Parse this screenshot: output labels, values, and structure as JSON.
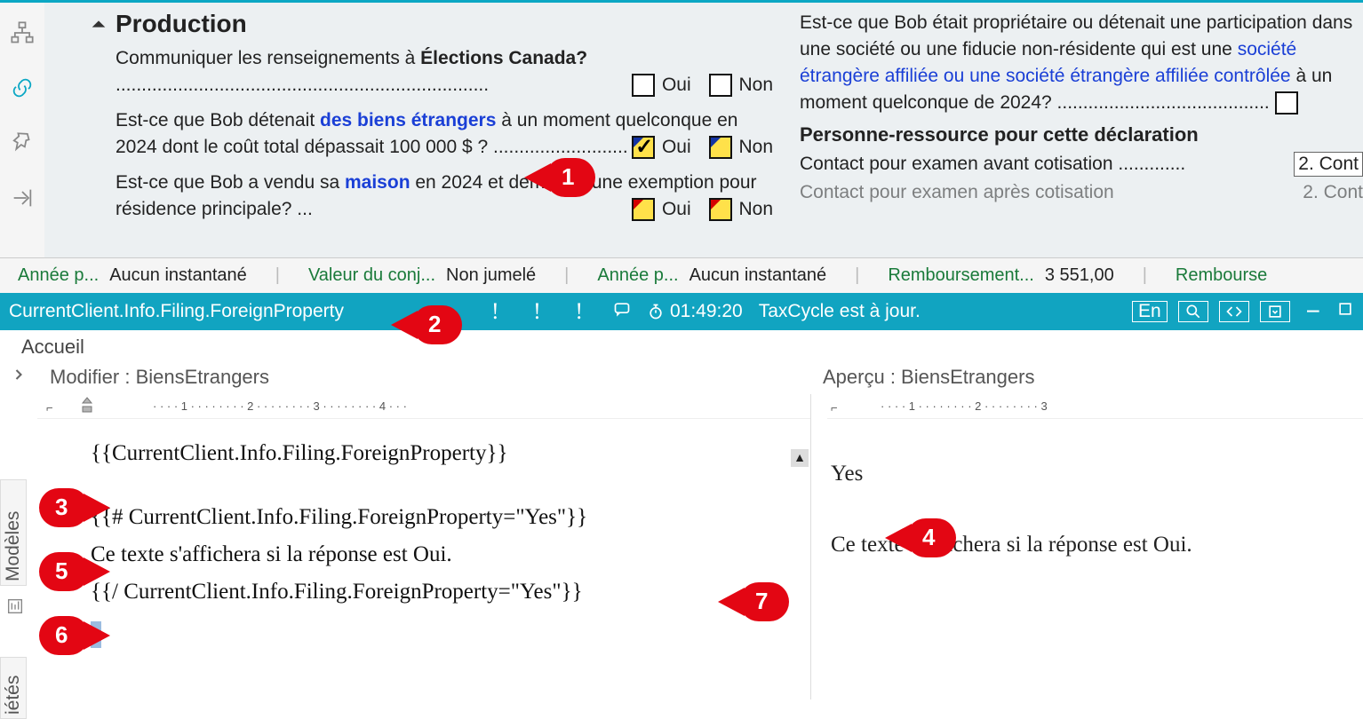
{
  "section": {
    "heading": "Production"
  },
  "questions": {
    "q1_part1": "Communiquer les renseignements à ",
    "q1_bold": "Élections Canada?",
    "q1_dots": "  ........................................................................",
    "q2_pre": "Est-ce que Bob détenait ",
    "q2_link": "des biens étrangers",
    "q2_post": " à un moment quelconque en 2024 dont le coût total dépassait 100 000 $ ?  .....................................",
    "q3_pre": "Est-ce que Bob a vendu sa ",
    "q3_link": "maison",
    "q3_post": " en 2024 et demande une exemption pour résidence principale? ...",
    "opt_yes": "Oui",
    "opt_no": "Non"
  },
  "col2": {
    "para_pre": "Est-ce que Bob était propriétaire ou détenait une participation dans une société ou une fiducie non-résidente qui est une ",
    "para_link": "société étrangère affiliée ou une société étrangère affiliée contrôlée",
    "para_post": " à un moment quelconque de 2024?  .........................................",
    "heading": "Personne-ressource pour cette déclaration",
    "contact1_label": "Contact pour examen avant cotisation   .............",
    "contact1_val": "2. Cont",
    "contact2_label": "Contact pour examen après cotisation",
    "contact2_val": "2. Cont"
  },
  "summary": {
    "s1a": "Année p...",
    "s1b": "Aucun instantané",
    "s2a": "Valeur du conj...",
    "s2b": "Non jumelé",
    "s3a": "Année p...",
    "s3b": "Aucun instantané",
    "s4a": "Remboursement...",
    "s4b": "3 551,00",
    "s5a": "Rembourse"
  },
  "status": {
    "path": "CurrentClient.Info.Filing.ForeignProperty",
    "excl": "!  !  !",
    "timer": "01:49:20",
    "msg": "TaxCycle est à jour.",
    "lang": "En"
  },
  "tab": {
    "home": "Accueil"
  },
  "panes": {
    "edit": "Modifier : BiensEtrangers",
    "preview": "Aperçu : BiensEtrangers"
  },
  "code": {
    "l1": "{{CurrentClient.Info.Filing.ForeignProperty}}",
    "l2": "{{# CurrentClient.Info.Filing.ForeignProperty=\"Yes\"}}",
    "l3": "Ce texte s'affichera si la réponse est Oui.",
    "l4": "{{/ CurrentClient.Info.Filing.ForeignProperty=\"Yes\"}}"
  },
  "preview": {
    "l1": "Yes",
    "l2": "Ce texte s'affichera si la réponse est Oui."
  },
  "vtabs": {
    "t1": "Modèles",
    "t2": "iétés"
  },
  "pins": {
    "p1": "1",
    "p2": "2",
    "p3": "3",
    "p4": "4",
    "p5": "5",
    "p6": "6",
    "p7": "7"
  }
}
